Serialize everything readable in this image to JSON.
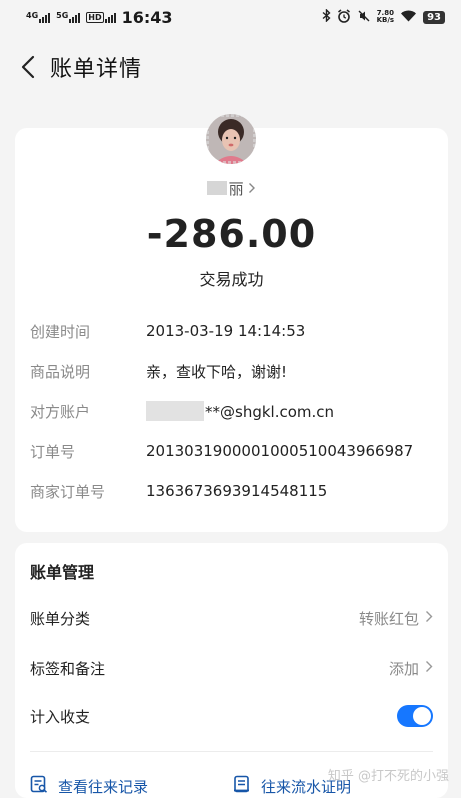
{
  "status_bar": {
    "net1": "4G",
    "net2": "5G",
    "hd": "HD",
    "time": "16:43",
    "speed_value": "7.80",
    "speed_unit": "KB/s",
    "battery": "93"
  },
  "nav": {
    "title": "账单详情"
  },
  "payee": {
    "name_suffix": "丽"
  },
  "amount": "-286.00",
  "trade_status": "交易成功",
  "details": [
    {
      "label": "创建时间",
      "value": "2013-03-19 14:14:53"
    },
    {
      "label": "商品说明",
      "value": "亲，查收下哈，谢谢!"
    },
    {
      "label": "对方账户",
      "value": "**@shgkl.com.cn"
    },
    {
      "label": "订单号",
      "value": "2013031900001000510043966987"
    },
    {
      "label": "商家订单号",
      "value": "1363673693914548115"
    }
  ],
  "manage": {
    "title": "账单管理",
    "category_label": "账单分类",
    "category_value": "转账红包",
    "tags_label": "标签和备注",
    "tags_value": "添加",
    "count_label": "计入收支",
    "count_enabled": true,
    "records_link": "查看往来记录",
    "proof_link": "往来流水证明"
  },
  "watermark": "知乎 @打不死的小强",
  "colors": {
    "accent": "#1677ff",
    "link": "#1756a8"
  }
}
